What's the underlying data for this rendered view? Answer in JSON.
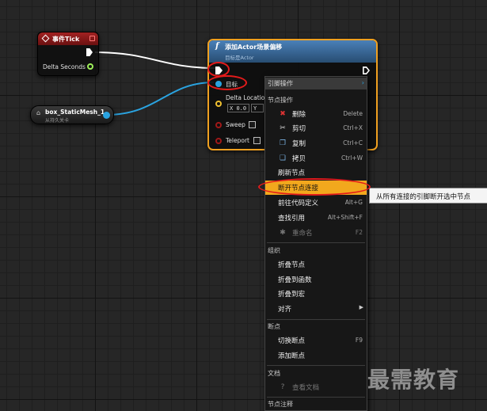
{
  "event_node": {
    "title": "事件Tick",
    "output_label": "Delta Seconds"
  },
  "variable_node": {
    "name": "box_StaticMesh_1",
    "subtitle": "从持久关卡"
  },
  "function_node": {
    "icon": "f",
    "title": "添加Actor场景偏移",
    "subtitle": "目标是Actor",
    "pins": {
      "target": "目标",
      "delta_location": "Delta Location",
      "x_prefix": "X",
      "x_value": "0.0",
      "y_prefix": "Y",
      "sweep": "Sweep",
      "teleport": "Teleport"
    }
  },
  "context_menu": {
    "header": "引脚操作",
    "sections": {
      "node_actions": "节点操作",
      "organize": "组织",
      "breakpoints": "断点",
      "documentation": "文档",
      "node_comment": "节点注释"
    },
    "items": {
      "delete": {
        "label": "删除",
        "shortcut": "Delete"
      },
      "cut": {
        "label": "剪切",
        "shortcut": "Ctrl+X"
      },
      "copy": {
        "label": "复制",
        "shortcut": "Ctrl+C"
      },
      "duplicate": {
        "label": "拷贝",
        "shortcut": "Ctrl+W"
      },
      "refresh": {
        "label": "刷新节点"
      },
      "break_links": {
        "label": "断开节点连接"
      },
      "goto_code": {
        "label": "前往代码定义",
        "shortcut": "Alt+G"
      },
      "find_refs": {
        "label": "查找引用",
        "shortcut": "Alt+Shift+F"
      },
      "rename": {
        "label": "重命名",
        "shortcut": "F2"
      },
      "collapse_nodes": {
        "label": "折叠节点"
      },
      "collapse_function": {
        "label": "折叠到函数"
      },
      "collapse_macro": {
        "label": "折叠到宏"
      },
      "align": {
        "label": "对齐"
      },
      "toggle_breakpoint": {
        "label": "切换断点",
        "shortcut": "F9"
      },
      "add_breakpoint": {
        "label": "添加断点"
      },
      "view_docs": {
        "label": "查看文档"
      }
    }
  },
  "tooltip": "从所有连接的引脚断开选中节点",
  "watermark": "最需教育",
  "colors": {
    "exec_wire": "#ffffff",
    "object_wire": "#2aa3e0",
    "highlight": "#f2a81d",
    "annotation": "#e31b1b",
    "selection_border": "#f0a020"
  }
}
